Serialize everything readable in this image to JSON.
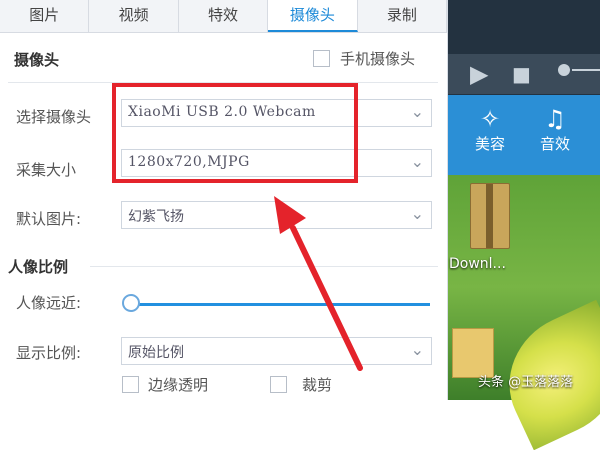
{
  "tabs": [
    "图片",
    "视频",
    "特效",
    "摄像头",
    "录制"
  ],
  "active_tab": "摄像头",
  "camera_section": {
    "title": "摄像头",
    "phone_camera_label": "手机摄像头",
    "select_camera_label": "选择摄像头",
    "select_camera_value": "XiaoMi USB 2.0 Webcam",
    "capture_size_label": "采集大小",
    "capture_size_value": "1280x720,MJPG",
    "default_image_label": "默认图片:",
    "default_image_value": "幻紫飞扬"
  },
  "portrait_section": {
    "title": "人像比例",
    "distance_label": "人像远近:",
    "distance_level": 0.0,
    "display_ratio_label": "显示比例:",
    "display_ratio_value": "原始比例",
    "edge_transparent_label": "边缘透明",
    "crop_label": "裁剪"
  },
  "actions": [
    {
      "icon": "magic-wand-icon",
      "label": "美容"
    },
    {
      "icon": "music-note-icon",
      "label": "音效"
    }
  ],
  "desktop": {
    "download_label": "Downl..."
  },
  "watermark": "头条 @玉落落落",
  "colors": {
    "accent": "#1d8ad8",
    "highlight": "#e4232b",
    "action_bar": "#2b8fd6"
  }
}
